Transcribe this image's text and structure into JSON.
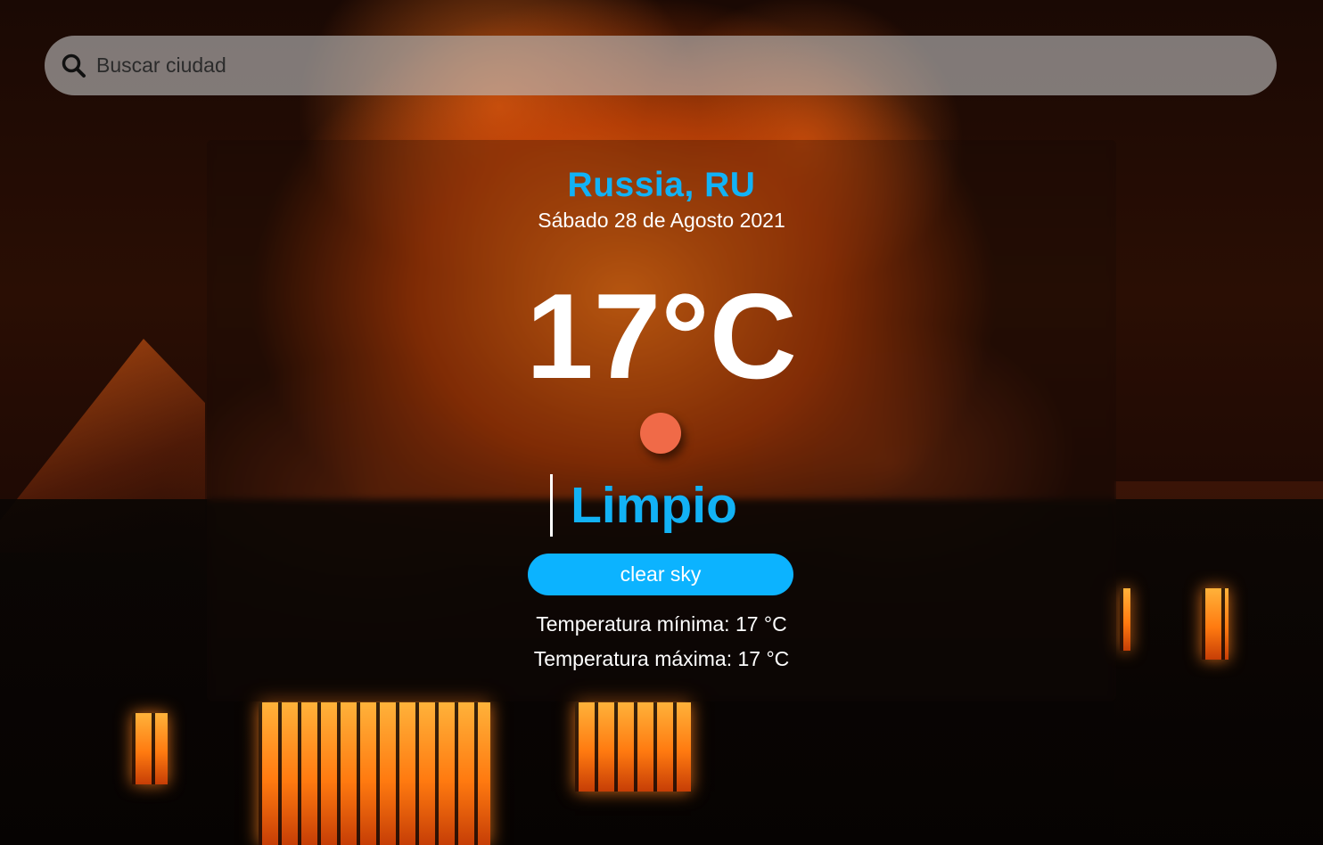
{
  "search": {
    "placeholder": "Buscar ciudad",
    "icon": "search-icon"
  },
  "weather": {
    "location": "Russia, RU",
    "date": "Sábado 28 de Agosto 2021",
    "temperature": "17°C",
    "icon": "sun-icon",
    "condition": "Limpio",
    "description": "clear sky",
    "temp_min": "Temperatura mínima: 17 °C",
    "temp_max": "Temperatura máxima: 17 °C"
  },
  "colors": {
    "accent": "#12b2f5",
    "pill": "#0cb3ff",
    "sun": "#f06a48"
  }
}
